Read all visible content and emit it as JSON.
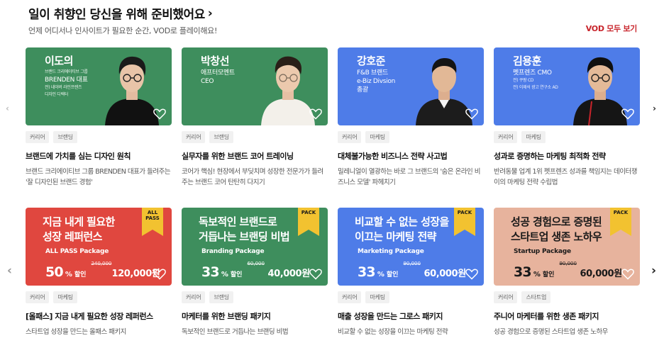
{
  "header": {
    "title": "일이 취향인 당신을 위해 준비했어요",
    "title_chevron": "›",
    "subtitle": "언제 어디서나 인사이트가 필요한 순간, VOD로 플레이해요!",
    "view_all": "VOD 모두 보기"
  },
  "nav": {
    "prev": "‹",
    "next": "›"
  },
  "colors": {
    "accent": "#c8242b",
    "green": "#3e8e5d",
    "blue": "#4e7ce8",
    "red": "#e0473f",
    "peach": "#e7b39d",
    "ribbon": "#f2c230"
  },
  "courses": [
    {
      "name": "이도의",
      "lines": [
        "브랜드 크리에이티브 그룹",
        "BRENDEN 대표",
        "전) 네이버 라인프렌즈",
        "디자인 디렉터"
      ],
      "tags": [
        "커리어",
        "브랜딩"
      ],
      "title": "브랜드에 가치를 심는 디자인 원칙",
      "desc": "브랜드 크리에이티브 그룹 BRENDEN 대표가 들려주는 '잘 디자인된 브랜드 경험'"
    },
    {
      "name": "박창선",
      "lines": [
        "애프터모멘트",
        "CEO"
      ],
      "tags": [
        "커리어",
        "브랜딩"
      ],
      "title": "실무자를 위한 브랜드 코어 트레이닝",
      "desc": "코어가 핵심! 현장에서 부딪치며 성장한 전문가가 들려주는 브랜드 코어 탄탄히 다지기"
    },
    {
      "name": "강호준",
      "lines": [
        "F&B 브랜드",
        "e-Biz Divsion",
        "총괄"
      ],
      "tags": [
        "커리어",
        "마케팅"
      ],
      "title": "대체불가능한 비즈니스 전략 사고법",
      "desc": "밀레니얼이 열광하는 바로 그 브랜드의 '숨은 온라인 비즈니스 모델' 파헤치기"
    },
    {
      "name": "김용훈",
      "lines": [
        "펫프렌즈 CMO",
        "전) 쿠팡 CD",
        "전) 이제석 광고 연구소 AD"
      ],
      "tags": [
        "커리어",
        "마케팅"
      ],
      "title": "성과로 증명하는 마케팅 최적화 전략",
      "desc": "반려동물 업계 1위 펫프렌즈 성과를 책임지는 데이터쟁이의 마케팅 전략 수립법"
    }
  ],
  "packages": [
    {
      "title_lines": [
        "지금 내게 필요한",
        "성장 레퍼런스"
      ],
      "subtitle": "ALL PASS Package",
      "ribbon": [
        "ALL",
        "PASS"
      ],
      "pct": "50",
      "pct_unit": "%",
      "disc_label": "할인",
      "orig": "240,000",
      "price": "120,000원",
      "tags": [
        "커리어",
        "마케팅"
      ],
      "title": "[올패스] 지금 내게 필요한 성장 레퍼런스",
      "desc": "스타트업 성장을 만드는 올패스 패키지"
    },
    {
      "title_lines": [
        "독보적인 브랜드로",
        "거듭나는 브랜딩 비법"
      ],
      "subtitle": "Branding Package",
      "ribbon": [
        "PACK"
      ],
      "pct": "33",
      "pct_unit": "%",
      "disc_label": "할인",
      "orig": "60,000",
      "price": "40,000원",
      "tags": [
        "커리어",
        "브랜딩"
      ],
      "title": "마케터를 위한 브랜딩 패키지",
      "desc": "독보적인 브랜드로 거듭나는 브랜딩 비법"
    },
    {
      "title_lines": [
        "비교할 수 없는 성장을",
        "이끄는 마케팅 전략"
      ],
      "subtitle": "Marketing Package",
      "ribbon": [
        "PACK"
      ],
      "pct": "33",
      "pct_unit": "%",
      "disc_label": "할인",
      "orig": "90,000",
      "price": "60,000원",
      "tags": [
        "커리어",
        "마케팅"
      ],
      "title": "매출 성장을 만드는 그로스 패키지",
      "desc": "비교할 수 없는 성장을 이끄는 마케팅 전략"
    },
    {
      "title_lines": [
        "성공 경험으로 증명된",
        "스타트업 생존 노하우"
      ],
      "subtitle": "Startup Package",
      "ribbon": [
        "PACK"
      ],
      "pct": "33",
      "pct_unit": "%",
      "disc_label": "할인",
      "orig": "90,000",
      "price": "60,000원",
      "tags": [
        "커리어",
        "스타트업"
      ],
      "title": "주니어 마케터를 위한 생존 패키지",
      "desc": "성공 경험으로 증명된 스타트업 생존 노하우"
    }
  ]
}
